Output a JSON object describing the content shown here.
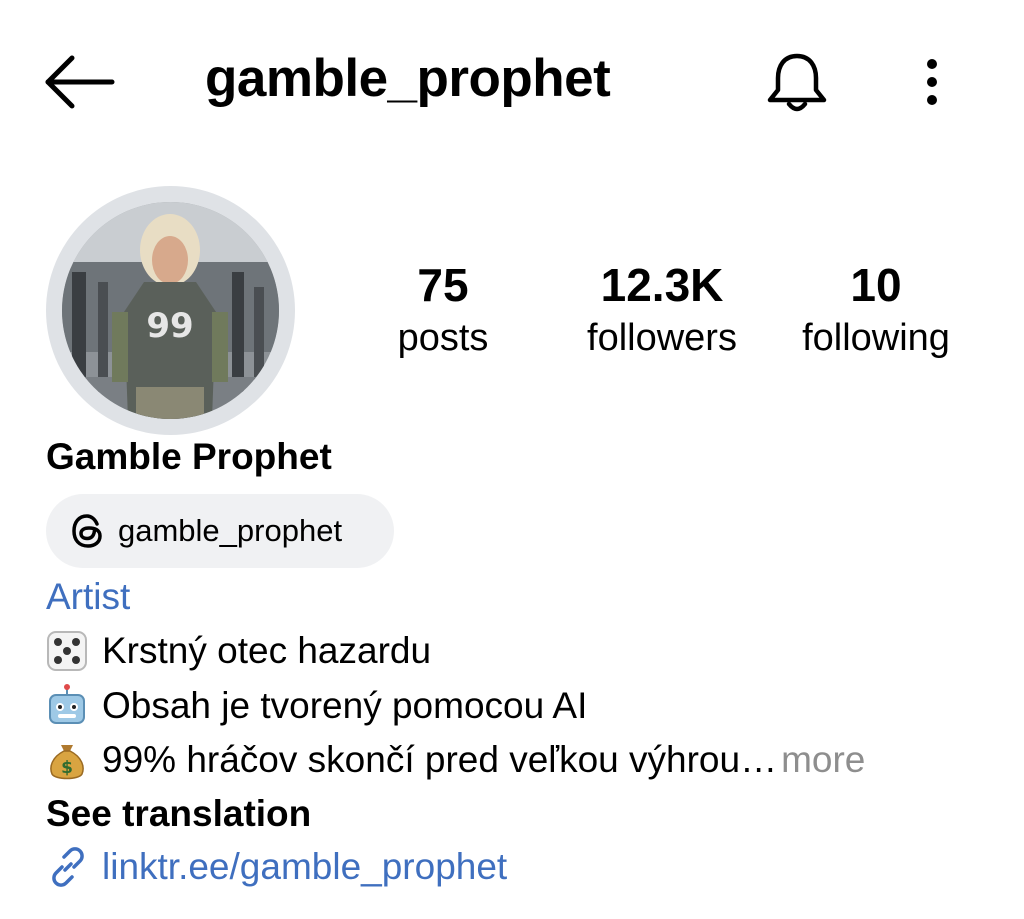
{
  "header": {
    "username": "gamble_prophet",
    "back_icon": "arrow-left-icon",
    "notification_icon": "bell-icon",
    "more_icon": "vertical-dots-icon"
  },
  "profile": {
    "stats": [
      {
        "value": "75",
        "label": "posts"
      },
      {
        "value": "12.3K",
        "label": "followers"
      },
      {
        "value": "10",
        "label": "following"
      }
    ],
    "display_name": "Gamble Prophet",
    "threads_handle": "gamble_prophet",
    "category": "Artist",
    "bio": [
      {
        "icon": "dice-emoji",
        "text": "Krstný otec hazardu"
      },
      {
        "icon": "robot-emoji",
        "text": "Obsah je tvorený pomocou AI"
      },
      {
        "icon": "money-bag-emoji",
        "text": "99% hráčov skončí pred veľkou výhrou",
        "ellipsis": "…",
        "more": "more"
      }
    ],
    "see_translation": "See translation",
    "link": "linktr.ee/gamble_prophet"
  },
  "colors": {
    "link_blue": "#3f6fbf",
    "muted_gray": "#8e8e8e",
    "chip_bg": "#f0f1f3",
    "avatar_ring": "#dfe2e6"
  }
}
